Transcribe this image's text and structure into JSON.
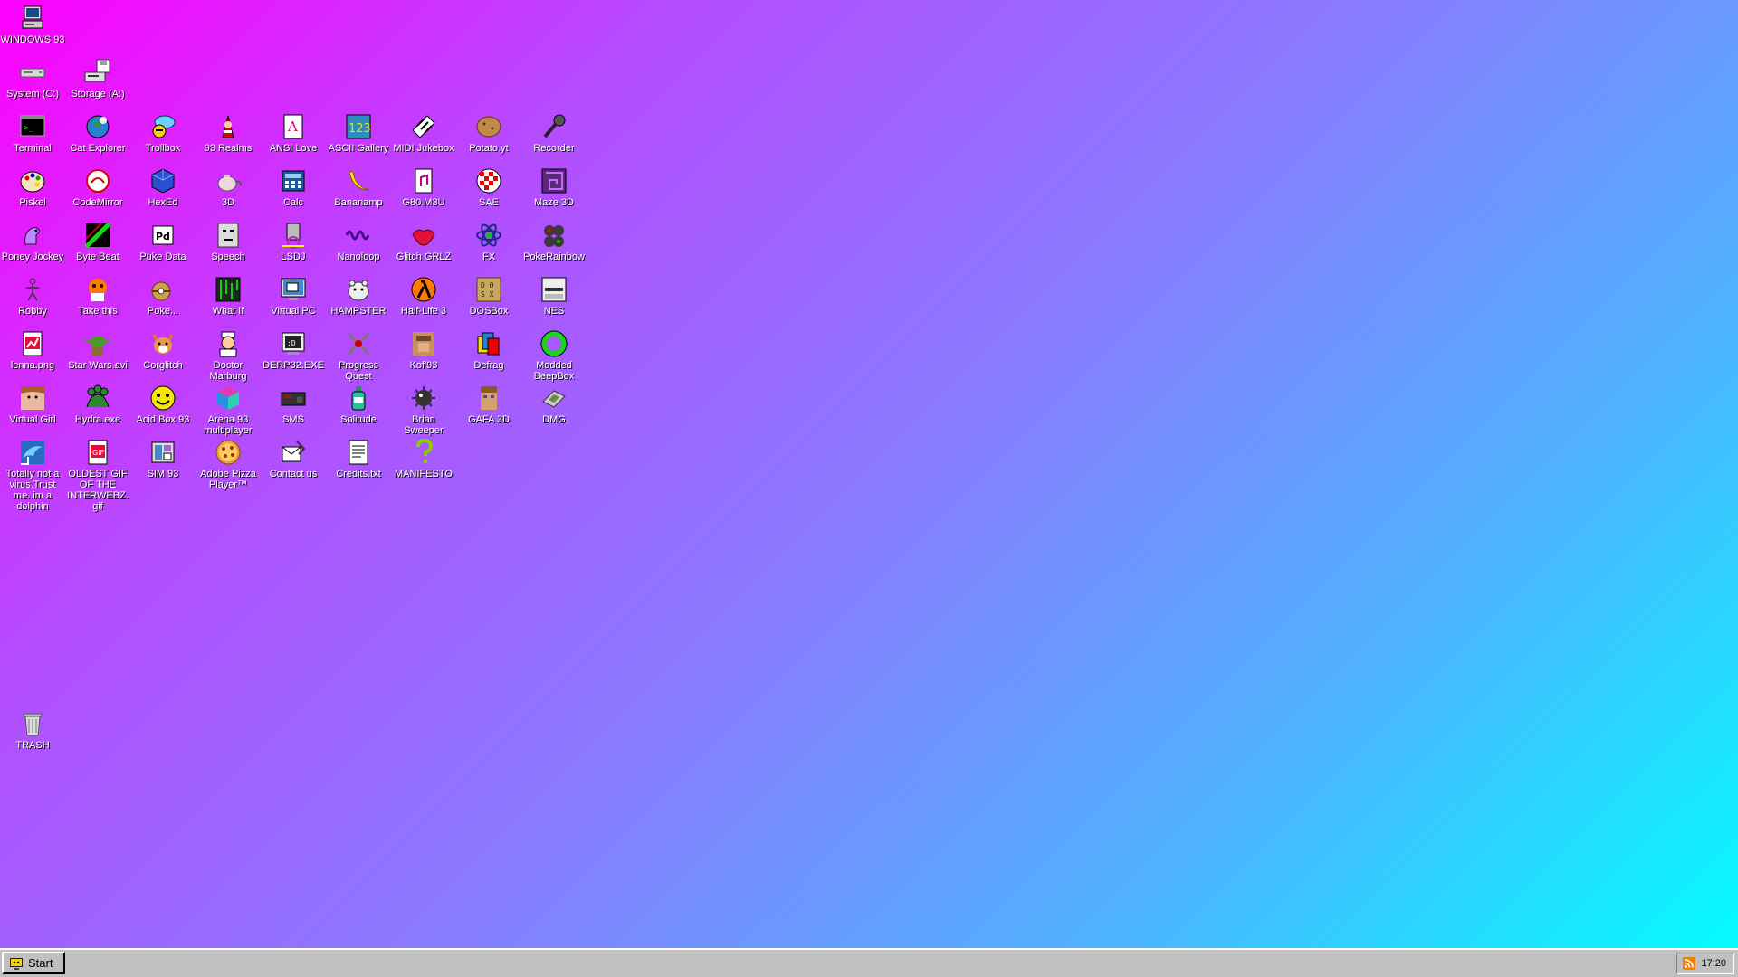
{
  "desktop": {
    "icons": [
      {
        "id": "windows93",
        "label": "WINDOWS 93",
        "col": 0,
        "row": 0,
        "icon": "computer-icon"
      },
      {
        "id": "system-c",
        "label": "System (C:)",
        "col": 0,
        "row": 1,
        "icon": "drive-icon"
      },
      {
        "id": "storage-a",
        "label": "Storage (A:)",
        "col": 1,
        "row": 1,
        "icon": "floppy-drive-icon"
      },
      {
        "id": "terminal",
        "label": "Terminal",
        "col": 0,
        "row": 2,
        "icon": "terminal-icon"
      },
      {
        "id": "cat-explorer",
        "label": "Cat Explorer",
        "col": 1,
        "row": 2,
        "icon": "globe-icon"
      },
      {
        "id": "trollbox",
        "label": "Trollbox",
        "col": 2,
        "row": 2,
        "icon": "chat-icon"
      },
      {
        "id": "93-realms",
        "label": "93 Realms",
        "col": 3,
        "row": 2,
        "icon": "mage-icon"
      },
      {
        "id": "ansi-love",
        "label": "ANSI Love",
        "col": 4,
        "row": 2,
        "icon": "ansi-icon"
      },
      {
        "id": "ascii-gallery",
        "label": "ASCII Gallery",
        "col": 5,
        "row": 2,
        "icon": "numbers-icon"
      },
      {
        "id": "midi-jukebox",
        "label": "MIDI Jukebox",
        "col": 6,
        "row": 2,
        "icon": "piano-icon"
      },
      {
        "id": "potato-yt",
        "label": "Potato.yt",
        "col": 7,
        "row": 2,
        "icon": "potato-icon"
      },
      {
        "id": "recorder",
        "label": "Recorder",
        "col": 8,
        "row": 2,
        "icon": "microphone-icon"
      },
      {
        "id": "piskel",
        "label": "Piskel",
        "col": 0,
        "row": 3,
        "icon": "palette-icon"
      },
      {
        "id": "codemirror",
        "label": "CodeMirror",
        "col": 1,
        "row": 3,
        "icon": "codemirror-icon"
      },
      {
        "id": "hexed",
        "label": "HexEd",
        "col": 2,
        "row": 3,
        "icon": "cube-icon"
      },
      {
        "id": "3d",
        "label": "3D",
        "col": 3,
        "row": 3,
        "icon": "teapot-icon"
      },
      {
        "id": "calc",
        "label": "Calc",
        "col": 4,
        "row": 3,
        "icon": "calculator-icon"
      },
      {
        "id": "bananamp",
        "label": "Bananamp",
        "col": 5,
        "row": 3,
        "icon": "banana-icon"
      },
      {
        "id": "g80m3u",
        "label": "G80.M3U",
        "col": 6,
        "row": 3,
        "icon": "music-file-icon"
      },
      {
        "id": "sae",
        "label": "SAE",
        "col": 7,
        "row": 3,
        "icon": "amiga-ball-icon"
      },
      {
        "id": "maze-3d",
        "label": "Maze 3D",
        "col": 8,
        "row": 3,
        "icon": "maze-icon"
      },
      {
        "id": "poney-jockey",
        "label": "Poney Jockey",
        "col": 0,
        "row": 4,
        "icon": "pony-icon"
      },
      {
        "id": "byte-beat",
        "label": "Byte Beat",
        "col": 1,
        "row": 4,
        "icon": "bytebeat-icon"
      },
      {
        "id": "puke-data",
        "label": "Puke Data",
        "col": 2,
        "row": 4,
        "icon": "puredata-icon"
      },
      {
        "id": "speech",
        "label": "Speech",
        "col": 3,
        "row": 4,
        "icon": "face-icon"
      },
      {
        "id": "lsdj",
        "label": "LSDJ",
        "col": 4,
        "row": 4,
        "icon": "lsdj-icon"
      },
      {
        "id": "nanoloop",
        "label": "Nanoloop",
        "col": 5,
        "row": 4,
        "icon": "wave-icon"
      },
      {
        "id": "glitch-grlz",
        "label": "Glitch GRLZ",
        "col": 6,
        "row": 4,
        "icon": "lips-icon"
      },
      {
        "id": "fx",
        "label": "FX",
        "col": 7,
        "row": 4,
        "icon": "atom-icon"
      },
      {
        "id": "pokerainbow",
        "label": "PokeRainbow",
        "col": 8,
        "row": 4,
        "icon": "pokerainbow-icon"
      },
      {
        "id": "robby",
        "label": "Robby",
        "col": 0,
        "row": 5,
        "icon": "stickman-icon"
      },
      {
        "id": "take-this",
        "label": "Take this",
        "col": 1,
        "row": 5,
        "icon": "old-man-icon"
      },
      {
        "id": "pokemon",
        "label": "Poke...",
        "col": 2,
        "row": 5,
        "icon": "pokeball-icon"
      },
      {
        "id": "what-if",
        "label": "What If",
        "col": 3,
        "row": 5,
        "icon": "matrix-icon"
      },
      {
        "id": "virtual-pc",
        "label": "Virtual PC",
        "col": 4,
        "row": 5,
        "icon": "virtual-pc-icon"
      },
      {
        "id": "hampster",
        "label": "HAMPSTER",
        "col": 5,
        "row": 5,
        "icon": "hamster-icon"
      },
      {
        "id": "half-life-3",
        "label": "Half-Life 3",
        "col": 6,
        "row": 5,
        "icon": "lambda-icon"
      },
      {
        "id": "dosbox",
        "label": "DOSBox",
        "col": 7,
        "row": 5,
        "icon": "dosbox-icon"
      },
      {
        "id": "nes",
        "label": "NES",
        "col": 8,
        "row": 5,
        "icon": "nes-icon"
      },
      {
        "id": "lenna",
        "label": "lenna.png",
        "col": 0,
        "row": 6,
        "icon": "image-file-icon"
      },
      {
        "id": "star-wars",
        "label": "Star Wars.avi",
        "col": 1,
        "row": 6,
        "icon": "yoda-icon"
      },
      {
        "id": "corglitch",
        "label": "Corglitch",
        "col": 2,
        "row": 6,
        "icon": "corgi-icon"
      },
      {
        "id": "doctor-marburg",
        "label": "Doctor Marburg",
        "col": 3,
        "row": 6,
        "icon": "doctor-icon"
      },
      {
        "id": "derp",
        "label": "DERP32.EXE",
        "col": 4,
        "row": 6,
        "icon": "derp-icon"
      },
      {
        "id": "progress-quest",
        "label": "Progress Quest",
        "col": 5,
        "row": 6,
        "icon": "swords-icon"
      },
      {
        "id": "kof93",
        "label": "Kof'93",
        "col": 6,
        "row": 6,
        "icon": "fighter-icon"
      },
      {
        "id": "defrag",
        "label": "Defrag",
        "col": 7,
        "row": 6,
        "icon": "defrag-icon"
      },
      {
        "id": "modded-beepbox",
        "label": "Modded BeepBox",
        "col": 8,
        "row": 6,
        "icon": "ring-icon"
      },
      {
        "id": "virtual-girl",
        "label": "Virtual Girl",
        "col": 0,
        "row": 7,
        "icon": "girl-icon"
      },
      {
        "id": "hydra",
        "label": "Hydra.exe",
        "col": 1,
        "row": 7,
        "icon": "hydra-icon"
      },
      {
        "id": "acid-box",
        "label": "Acid Box 93",
        "col": 2,
        "row": 7,
        "icon": "smiley-icon"
      },
      {
        "id": "arena-93",
        "label": "Arena 93 multiplayer",
        "col": 3,
        "row": 7,
        "icon": "colorcube-icon"
      },
      {
        "id": "sms",
        "label": "SMS",
        "col": 4,
        "row": 7,
        "icon": "console-icon"
      },
      {
        "id": "solitude",
        "label": "Solitude",
        "col": 5,
        "row": 7,
        "icon": "bottle-icon"
      },
      {
        "id": "brian-sweeper",
        "label": "Brian Sweeper",
        "col": 6,
        "row": 7,
        "icon": "mine-icon"
      },
      {
        "id": "gafa-3d",
        "label": "GAFA 3D",
        "col": 7,
        "row": 7,
        "icon": "wolf-guy-icon"
      },
      {
        "id": "dmg",
        "label": "DMG",
        "col": 8,
        "row": 7,
        "icon": "gameboy-icon"
      },
      {
        "id": "dolphin",
        "label": "Totally not a virus.Trust me..im a dolphin",
        "col": 0,
        "row": 8,
        "icon": "dolphin-icon"
      },
      {
        "id": "oldest-gif",
        "label": "OLDEST GIF OF THE INTERWEBZ.gif",
        "col": 1,
        "row": 8,
        "icon": "gif-file-icon"
      },
      {
        "id": "sim93",
        "label": "SIM 93",
        "col": 2,
        "row": 8,
        "icon": "sim-icon"
      },
      {
        "id": "adobe-pizza",
        "label": "Adobe Pizza Player™",
        "col": 3,
        "row": 8,
        "icon": "pizza-icon"
      },
      {
        "id": "contact-us",
        "label": "Contact us",
        "col": 4,
        "row": 8,
        "icon": "contact-icon"
      },
      {
        "id": "credits",
        "label": "Credits.txt",
        "col": 5,
        "row": 8,
        "icon": "text-file-icon"
      },
      {
        "id": "manifesto",
        "label": "MANIFESTO",
        "col": 6,
        "row": 8,
        "icon": "question-icon"
      }
    ],
    "trash": {
      "label": "TRASH",
      "icon": "trash-icon"
    }
  },
  "taskbar": {
    "start_label": "Start",
    "clock": "17:20"
  },
  "colors": {
    "gradient_start": "#ff00ff",
    "gradient_end": "#00ffff",
    "taskbar": "#c0c0c0"
  }
}
